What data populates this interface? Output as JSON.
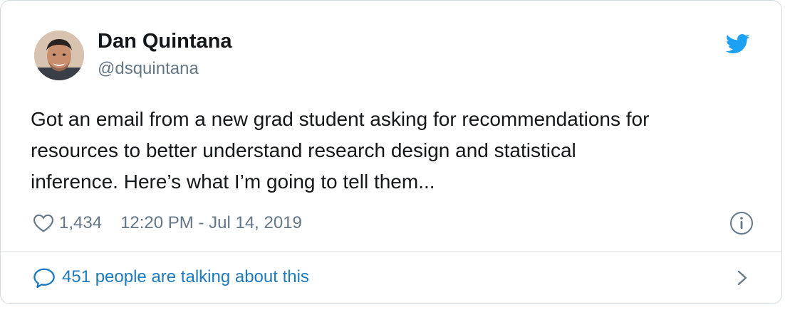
{
  "author": {
    "name": "Dan Quintana",
    "handle": "@dsquintana"
  },
  "tweet": {
    "text_lines": [
      "Got an email from a new grad student asking for recommendations for",
      "resources to better understand research design and statistical",
      "inference. Here’s what I’m going to tell them..."
    ]
  },
  "meta": {
    "like_count": "1,434",
    "timestamp": "12:20 PM - Jul 14, 2019"
  },
  "conversation": {
    "label": "451 people are talking about this"
  },
  "icons": {
    "brand": "twitter-bird-icon",
    "like": "heart-icon",
    "info": "info-icon",
    "reply": "speech-bubble-icon",
    "navigate": "chevron-right-icon"
  },
  "colors": {
    "twitter_blue": "#1da1f2",
    "link_blue": "#1b7ac0",
    "muted_gray": "#657786",
    "text_dark": "#14171a",
    "border": "#cfd9de"
  }
}
